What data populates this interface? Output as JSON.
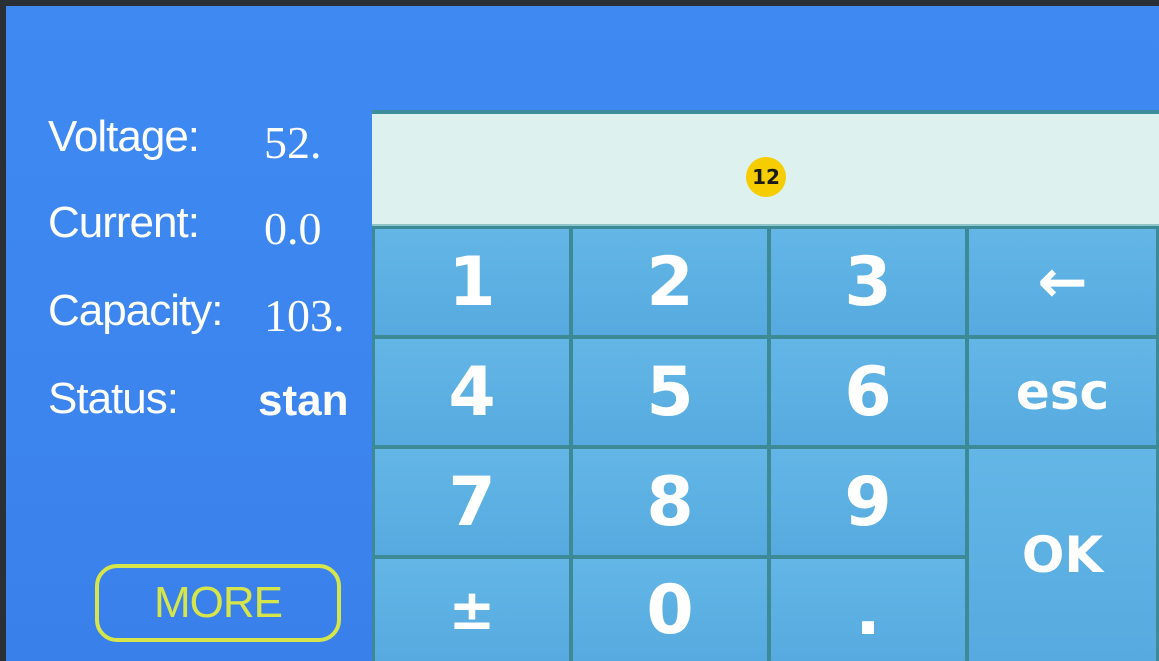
{
  "readout": {
    "voltage_label": "Voltage:",
    "voltage_value": "52.",
    "current_label": "Current:",
    "current_value": "0.0",
    "capacity_label": "Capacity:",
    "capacity_value": "103.",
    "status_label": "Status:",
    "status_value": "stan"
  },
  "more_button": "MORE",
  "keypad": {
    "display_value": "",
    "marker": "12",
    "keys": {
      "k1": "1",
      "k2": "2",
      "k3": "3",
      "backspace": "←",
      "k4": "4",
      "k5": "5",
      "k6": "6",
      "esc": "esc",
      "k7": "7",
      "k8": "8",
      "k9": "9",
      "ok": "OK",
      "plusminus": "±",
      "k0": "0",
      "dot": "."
    }
  },
  "colors": {
    "screen_bg": "#3d86f0",
    "key_bg": "#5aaee2",
    "key_border": "#3b8a96",
    "display_bg": "#ddf1ee",
    "more_button": "#d6e64a",
    "marker": "#f5cd00"
  }
}
